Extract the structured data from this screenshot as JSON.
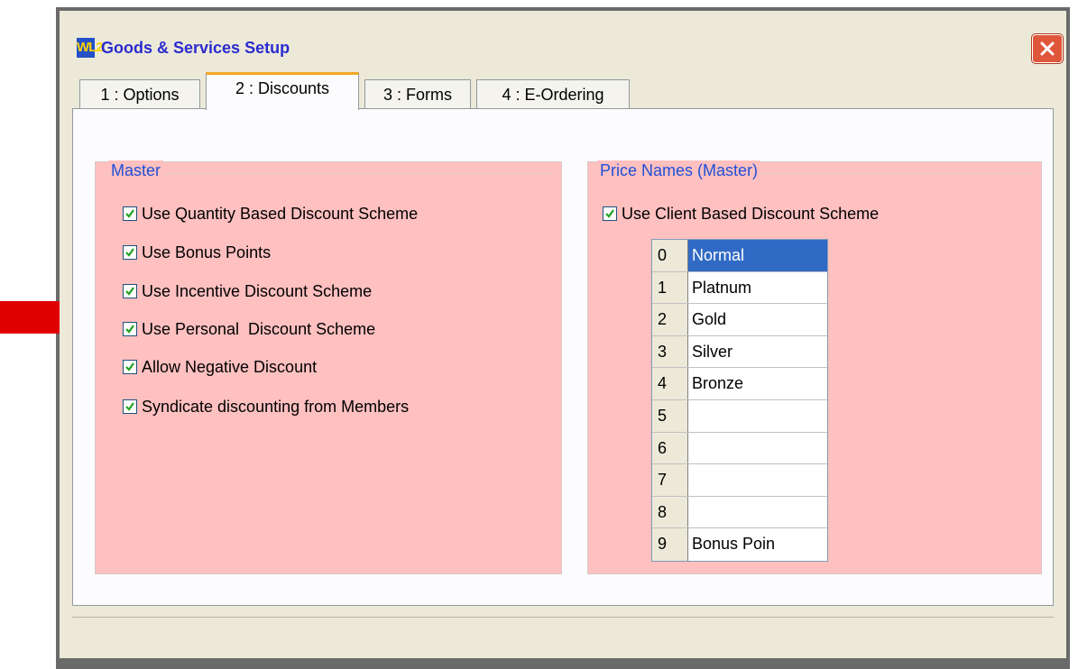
{
  "window": {
    "title": "Goods & Services Setup",
    "icon_label": "WL2"
  },
  "tabs": [
    {
      "label": "1 : Options",
      "active": false
    },
    {
      "label": "2 : Discounts",
      "active": true
    },
    {
      "label": "3 : Forms",
      "active": false
    },
    {
      "label": "4 : E-Ordering",
      "active": false
    }
  ],
  "master": {
    "title": "Master",
    "options": [
      {
        "label": "Use Quantity Based Discount Scheme",
        "checked": true
      },
      {
        "label": "Use Bonus Points",
        "checked": true
      },
      {
        "label": "Use Incentive Discount Scheme",
        "checked": true
      },
      {
        "label": "Use Personal  Discount Scheme",
        "checked": true
      },
      {
        "label": "Allow Negative Discount",
        "checked": true
      },
      {
        "label": "Syndicate discounting from Members",
        "checked": true
      }
    ]
  },
  "price_names": {
    "title": "Price Names (Master)",
    "client_option": {
      "label": "Use Client Based Discount Scheme",
      "checked": true
    },
    "rows": [
      {
        "num": "0",
        "name": "Normal",
        "selected": true
      },
      {
        "num": "1",
        "name": "Platnum"
      },
      {
        "num": "2",
        "name": "Gold"
      },
      {
        "num": "3",
        "name": "Silver"
      },
      {
        "num": "4",
        "name": "Bronze"
      },
      {
        "num": "5",
        "name": ""
      },
      {
        "num": "6",
        "name": ""
      },
      {
        "num": "7",
        "name": ""
      },
      {
        "num": "8",
        "name": ""
      },
      {
        "num": "9",
        "name": "Bonus Poin"
      }
    ]
  },
  "annotation": {
    "icon": "red-arrow-icon",
    "color": "#e00000"
  },
  "colors": {
    "group_background": "#ffc0c0",
    "group_title": "#1f4fd8",
    "selection": "#316ac5",
    "active_tab_accent": "#f5a623"
  }
}
